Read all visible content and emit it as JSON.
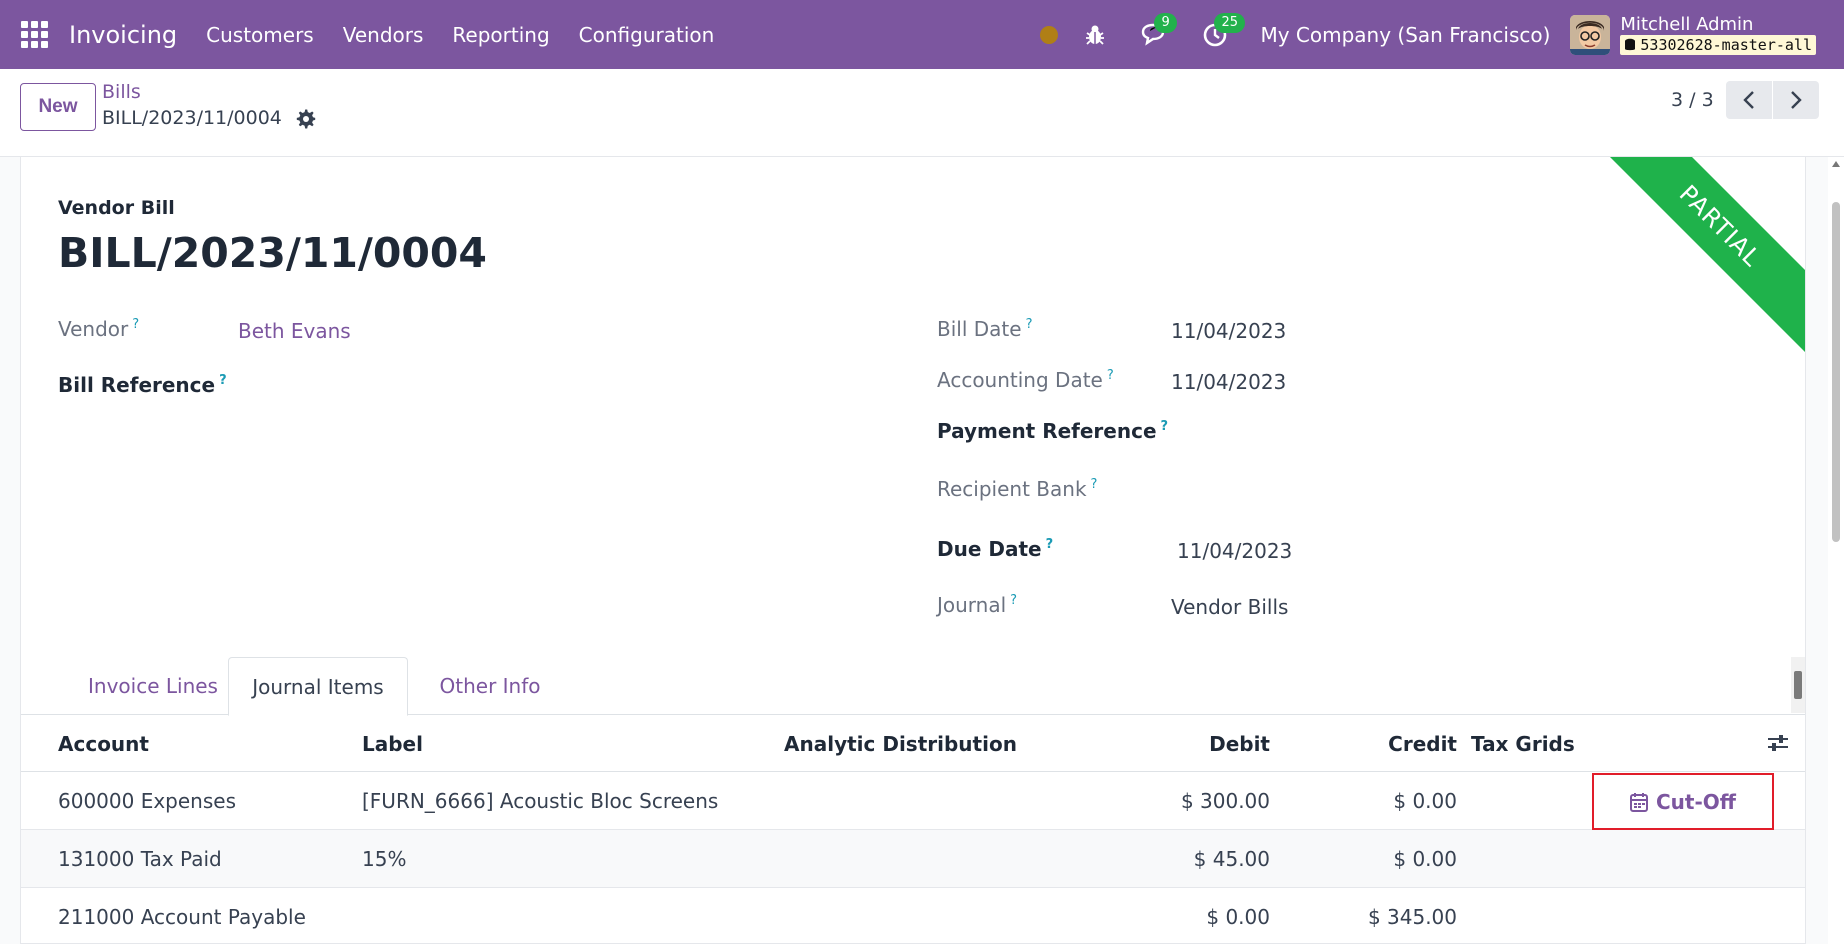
{
  "navbar": {
    "brand": "Invoicing",
    "menu": [
      "Customers",
      "Vendors",
      "Reporting",
      "Configuration"
    ],
    "messages_badge": "9",
    "activities_badge": "25",
    "company": "My Company (San Francisco)",
    "user_name": "Mitchell Admin",
    "db_name": "53302628-master-all"
  },
  "control_panel": {
    "new_label": "New",
    "breadcrumb": "Bills",
    "record_name": "BILL/2023/11/0004",
    "pager": "3 / 3"
  },
  "form": {
    "doc_type": "Vendor Bill",
    "title": "BILL/2023/11/0004",
    "ribbon": "PARTIAL",
    "help_mark": "?",
    "left_fields": {
      "vendor_label": "Vendor",
      "vendor_value": "Beth Evans",
      "bill_reference_label": "Bill Reference"
    },
    "right_fields": {
      "bill_date_label": "Bill Date",
      "bill_date_value": "11/04/2023",
      "accounting_date_label": "Accounting Date",
      "accounting_date_value": "11/04/2023",
      "payment_reference_label": "Payment Reference",
      "recipient_bank_label": "Recipient Bank",
      "due_date_label": "Due Date",
      "due_date_value": "11/04/2023",
      "journal_label": "Journal",
      "journal_value": "Vendor Bills"
    }
  },
  "tabs": [
    "Invoice Lines",
    "Journal Items",
    "Other Info"
  ],
  "active_tab": "Journal Items",
  "journal_items": {
    "columns": [
      "Account",
      "Label",
      "Analytic Distribution",
      "Debit",
      "Credit",
      "Tax Grids"
    ],
    "rows": [
      {
        "account": "600000 Expenses",
        "label": "[FURN_6666] Acoustic Bloc Screens",
        "debit": "$ 300.00",
        "credit": "$ 0.00"
      },
      {
        "account": "131000 Tax Paid",
        "label": "15%",
        "debit": "$ 45.00",
        "credit": "$ 0.00"
      },
      {
        "account": "211000 Account Payable",
        "label": "",
        "debit": "$ 0.00",
        "credit": "$ 345.00"
      }
    ],
    "cutoff_label": "Cut-Off"
  },
  "colors": {
    "brand": "#7c569f",
    "ribbon": "#1fb24b",
    "badge": "#22b14c",
    "highlight": "#e11d2a"
  }
}
